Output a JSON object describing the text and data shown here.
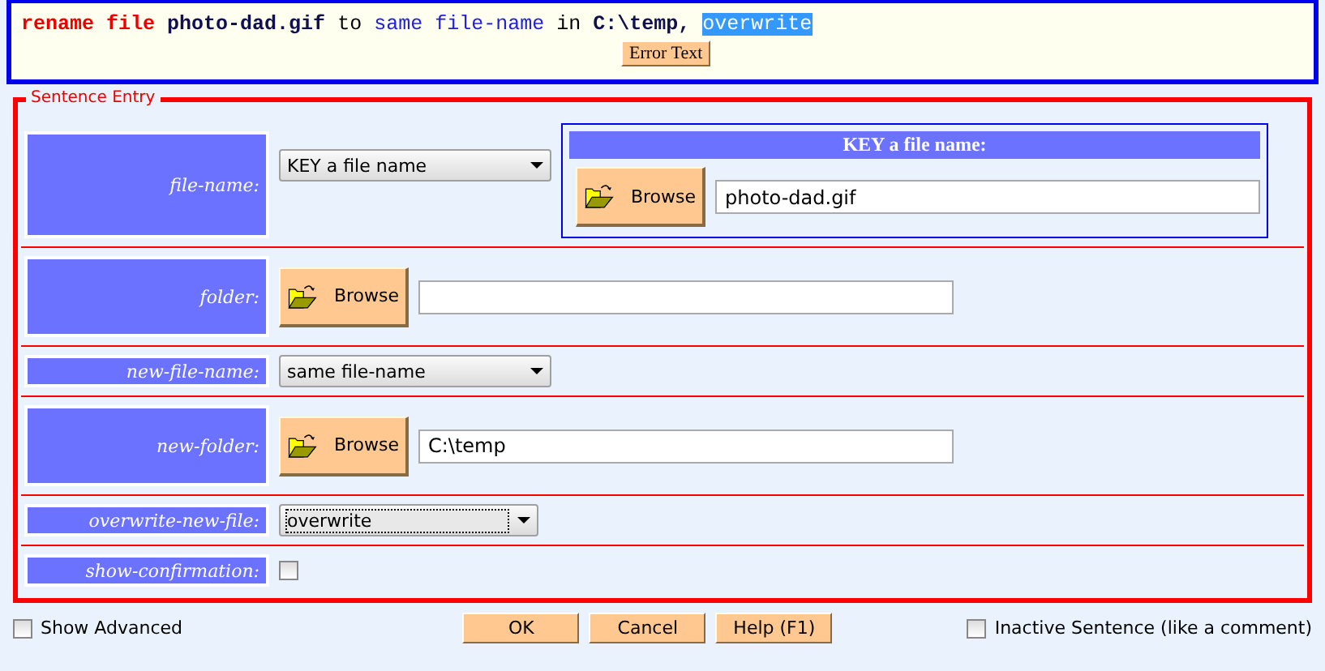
{
  "sentence": {
    "tokens": [
      {
        "text": "rename",
        "kind": "keyword",
        "selected": false
      },
      {
        "text": "file",
        "kind": "keyword",
        "selected": false
      },
      {
        "text": "photo-dad.gif",
        "kind": "value",
        "selected": false
      },
      {
        "text": "to",
        "kind": "plain",
        "selected": false
      },
      {
        "text": "same file-name",
        "kind": "choice",
        "selected": false
      },
      {
        "text": "in",
        "kind": "plain",
        "selected": false
      },
      {
        "text": "C:\\temp,",
        "kind": "value",
        "selected": false
      },
      {
        "text": "overwrite",
        "kind": "choice",
        "selected": true
      }
    ],
    "error_button": "Error Text"
  },
  "entry": {
    "legend": "Sentence Entry",
    "rows": [
      {
        "label": "file-name:",
        "kind": "select",
        "value": "KEY a file name",
        "focused": false,
        "key_panel": {
          "title": "KEY a file name:",
          "browse": "Browse",
          "value": "photo-dad.gif"
        }
      },
      {
        "label": "folder:",
        "kind": "browse",
        "browse": "Browse"
      },
      {
        "label": "new-file-name:",
        "kind": "select",
        "value": "same file-name",
        "focused": false
      },
      {
        "label": "new-folder:",
        "kind": "browse",
        "browse": "Browse",
        "value": "C:\\temp"
      },
      {
        "label": "overwrite-new-file:",
        "kind": "select",
        "value": "overwrite",
        "focused": true
      },
      {
        "label": "show-confirmation:",
        "kind": "checkbox",
        "checked": false
      }
    ]
  },
  "footer": {
    "show_advanced": {
      "label": "Show Advanced",
      "checked": false
    },
    "buttons": [
      "OK",
      "Cancel",
      "Help (F1)"
    ],
    "inactive": {
      "label": "Inactive Sentence (like a comment)",
      "checked": false
    }
  }
}
